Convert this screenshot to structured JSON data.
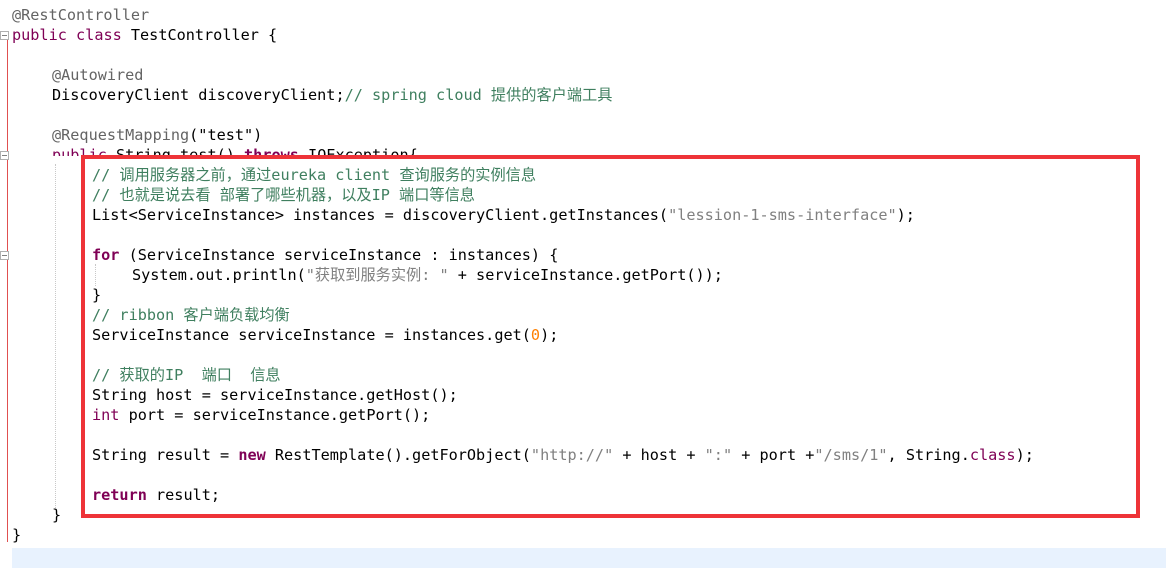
{
  "code": {
    "l1": "@RestController",
    "l2_public": "public",
    "l2_class": "class",
    "l2_name": " TestController {",
    "l4": "@Autowired",
    "l5_code": "DiscoveryClient discoveryClient;",
    "l5_comment": "// spring cloud 提供的客户端工具",
    "l7_ann": "@RequestMapping",
    "l7_rest": "(\"test\")",
    "l8_public": "public",
    "l8_rest": " String test() ",
    "l8_throws": "throws",
    "l8_end": " IOException{",
    "c1": "// 调用服务器之前，通过eureka client 查询服务的实例信息",
    "c2": "// 也就是说去看 部署了哪些机器，以及IP 端口等信息",
    "l11_a": "List<ServiceInstance> instances = discoveryClient.getInstances(",
    "l11_str": "\"lession-1-sms-interface\"",
    "l11_b": ");",
    "l13_for": "for",
    "l13_rest": " (ServiceInstance serviceInstance : instances) {",
    "l14_a": "System.out.println(",
    "l14_str": "\"获取到服务实例: \"",
    "l14_b": " + serviceInstance.getPort());",
    "l15": "}",
    "c3": "// ribbon 客户端负载均衡",
    "l17_a": "ServiceInstance serviceInstance = instances.get(",
    "l17_num": "0",
    "l17_b": ");",
    "c4": "// 获取的IP  端口  信息",
    "l20": "String host = serviceInstance.getHost();",
    "l21_int": "int",
    "l21_rest": " port = serviceInstance.getPort();",
    "l23_a": "String result = ",
    "l23_new": "new",
    "l23_b": " RestTemplate().getForObject(",
    "l23_s1": "\"http://\"",
    "l23_c": " + host + ",
    "l23_s2": "\":\"",
    "l23_d": " + port +",
    "l23_s3": "\"/sms/1\"",
    "l23_e": ", String.",
    "l23_class": "class",
    "l23_f": ");",
    "l25_return": "return",
    "l25_rest": " result;",
    "l26": "}",
    "l27": "}"
  },
  "colors": {
    "highlight_border": "#ee3338",
    "keyword": "#7f0055",
    "comment": "#3f7f5f",
    "string": "#808080",
    "number": "#ff8000"
  }
}
